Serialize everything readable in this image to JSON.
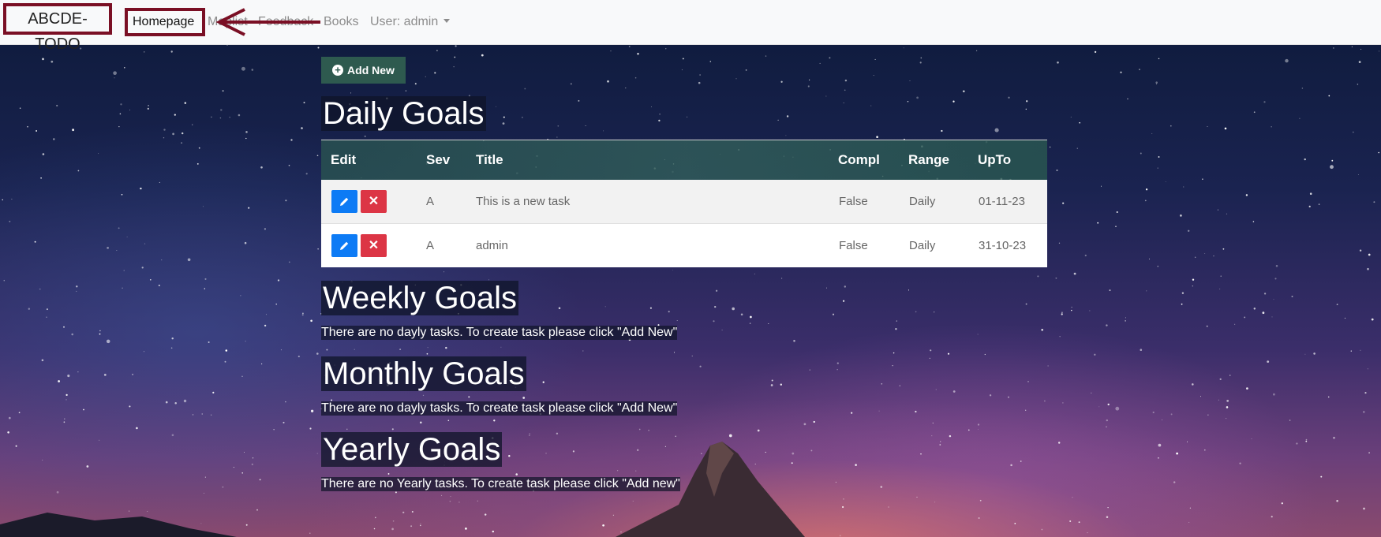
{
  "navbar": {
    "brand": "ABCDE-TODO",
    "items": [
      {
        "label": "Homepage"
      },
      {
        "label": "Maplist"
      },
      {
        "label": "Feedback"
      },
      {
        "label": "Books"
      },
      {
        "label": "User: admin"
      }
    ]
  },
  "add_button": {
    "label": "Add New",
    "icon": "plus-circle-icon"
  },
  "daily": {
    "title": "Daily Goals",
    "columns": [
      "Edit",
      "Sev",
      "Title",
      "Compl",
      "Range",
      "UpTo"
    ],
    "rows": [
      {
        "sev": "A",
        "title": "This is a new task",
        "compl": "False",
        "range": "Daily",
        "upto": "01-11-23"
      },
      {
        "sev": "A",
        "title": "admin",
        "compl": "False",
        "range": "Daily",
        "upto": "31-10-23"
      }
    ]
  },
  "weekly": {
    "title": "Weekly Goals",
    "message": "There are no dayly tasks. To create task please click \"Add New\""
  },
  "monthly": {
    "title": "Monthly Goals",
    "message": "There are no dayly tasks. To create task please click \"Add New\""
  },
  "yearly": {
    "title": "Yearly Goals",
    "message": "There are no Yearly tasks. To create task please click \"Add new\""
  },
  "colors": {
    "highlight": "#7a0f24",
    "add_button": "#2e5a4f",
    "edit": "#0d7bf5",
    "delete": "#dc3545"
  }
}
